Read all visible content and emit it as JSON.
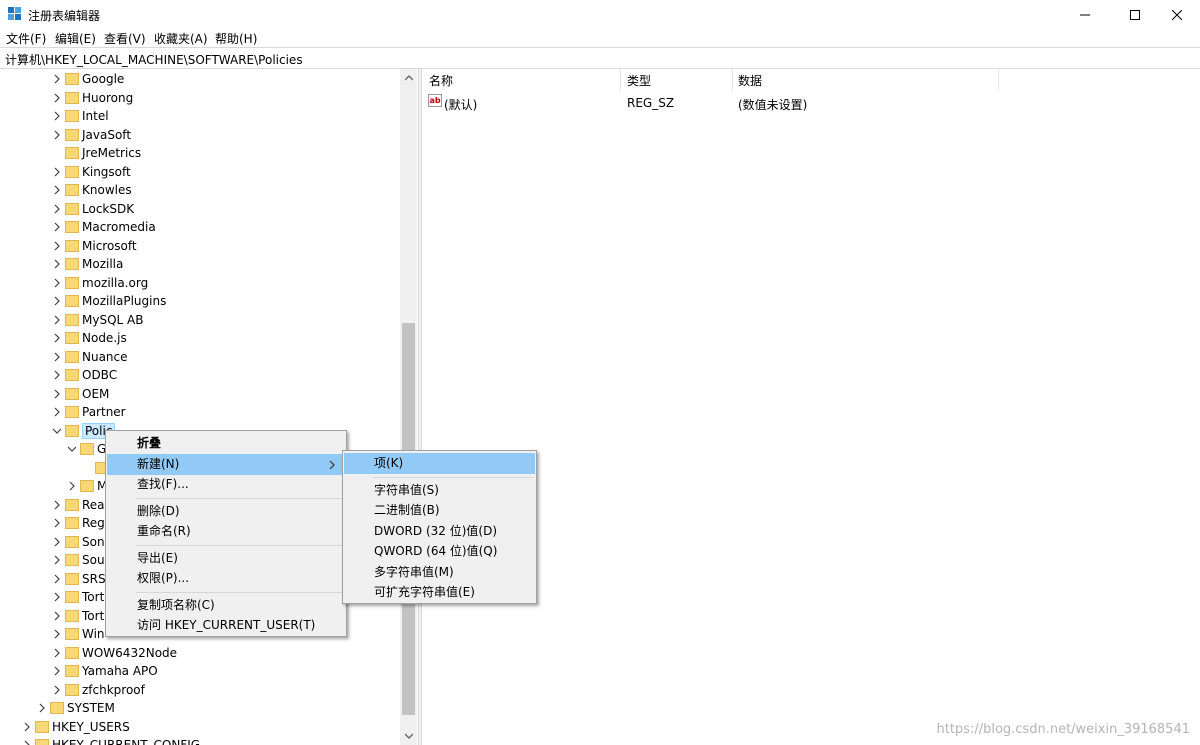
{
  "window": {
    "title": "注册表编辑器",
    "min_label": "─",
    "max_label": "☐",
    "close_label": "✕"
  },
  "menu": [
    "文件(F)",
    "编辑(E)",
    "查看(V)",
    "收藏夹(A)",
    "帮助(H)"
  ],
  "address": "计算机\\HKEY_LOCAL_MACHINE\\SOFTWARE\\Policies",
  "tree": {
    "items": [
      {
        "label": "Google",
        "expander": true
      },
      {
        "label": "Huorong",
        "expander": true
      },
      {
        "label": "Intel",
        "expander": true
      },
      {
        "label": "JavaSoft",
        "expander": true
      },
      {
        "label": "JreMetrics",
        "expander": false
      },
      {
        "label": "Kingsoft",
        "expander": true
      },
      {
        "label": "Knowles",
        "expander": true
      },
      {
        "label": "LockSDK",
        "expander": true
      },
      {
        "label": "Macromedia",
        "expander": true
      },
      {
        "label": "Microsoft",
        "expander": true
      },
      {
        "label": "Mozilla",
        "expander": true
      },
      {
        "label": "mozilla.org",
        "expander": true
      },
      {
        "label": "MozillaPlugins",
        "expander": true
      },
      {
        "label": "MySQL AB",
        "expander": true
      },
      {
        "label": "Node.js",
        "expander": true
      },
      {
        "label": "Nuance",
        "expander": true
      },
      {
        "label": "ODBC",
        "expander": true
      },
      {
        "label": "OEM",
        "expander": true
      },
      {
        "label": "Partner",
        "expander": true
      },
      {
        "label": "Polic",
        "expander": true,
        "expanded": true,
        "selected": true
      },
      {
        "label": "G",
        "expander": true,
        "expanded": true,
        "level": 2
      },
      {
        "label": "",
        "expander": false,
        "level": 3
      },
      {
        "label": "M",
        "expander": true,
        "level": 2
      },
      {
        "label": "Rea",
        "expander": true
      },
      {
        "label": "Reg",
        "expander": true
      },
      {
        "label": "Son",
        "expander": true
      },
      {
        "label": "Sou",
        "expander": true
      },
      {
        "label": "SRS",
        "expander": true
      },
      {
        "label": "Tort",
        "expander": true
      },
      {
        "label": "Tort",
        "expander": true
      },
      {
        "label": "Win",
        "expander": true
      },
      {
        "label": "WOW6432Node",
        "expander": true
      },
      {
        "label": "Yamaha APO",
        "expander": true
      },
      {
        "label": "zfchkproof",
        "expander": true
      },
      {
        "label": "SYSTEM",
        "expander": true,
        "level": 0
      },
      {
        "label": "HKEY_USERS",
        "expander": true,
        "level": -1
      },
      {
        "label": "HKEY_CURRENT_CONFIG",
        "expander": true,
        "level": -1
      }
    ]
  },
  "list": {
    "columns": [
      "名称",
      "类型",
      "数据"
    ],
    "rows": [
      {
        "name": "(默认)",
        "type": "REG_SZ",
        "data": "(数值未设置)",
        "icon": "ab"
      }
    ]
  },
  "context_menu": {
    "items": [
      {
        "label": "折叠",
        "bold": true
      },
      {
        "label": "新建(N)",
        "submenu": true,
        "highlight": true
      },
      {
        "label": "查找(F)..."
      },
      {
        "sep": true
      },
      {
        "label": "删除(D)"
      },
      {
        "label": "重命名(R)"
      },
      {
        "sep": true
      },
      {
        "label": "导出(E)"
      },
      {
        "label": "权限(P)..."
      },
      {
        "sep": true
      },
      {
        "label": "复制项名称(C)"
      },
      {
        "label": "访问 HKEY_CURRENT_USER(T)"
      }
    ]
  },
  "submenu": {
    "items": [
      {
        "label": "项(K)",
        "highlight": true
      },
      {
        "sep": true
      },
      {
        "label": "字符串值(S)"
      },
      {
        "label": "二进制值(B)"
      },
      {
        "label": "DWORD (32 位)值(D)"
      },
      {
        "label": "QWORD (64 位)值(Q)"
      },
      {
        "label": "多字符串值(M)"
      },
      {
        "label": "可扩充字符串值(E)"
      }
    ]
  },
  "watermark": "https://blog.csdn.net/weixin_39168541",
  "colors": {
    "highlight": "#91c9f7",
    "selection": "#cce8ff",
    "folder": "#f8d775"
  }
}
